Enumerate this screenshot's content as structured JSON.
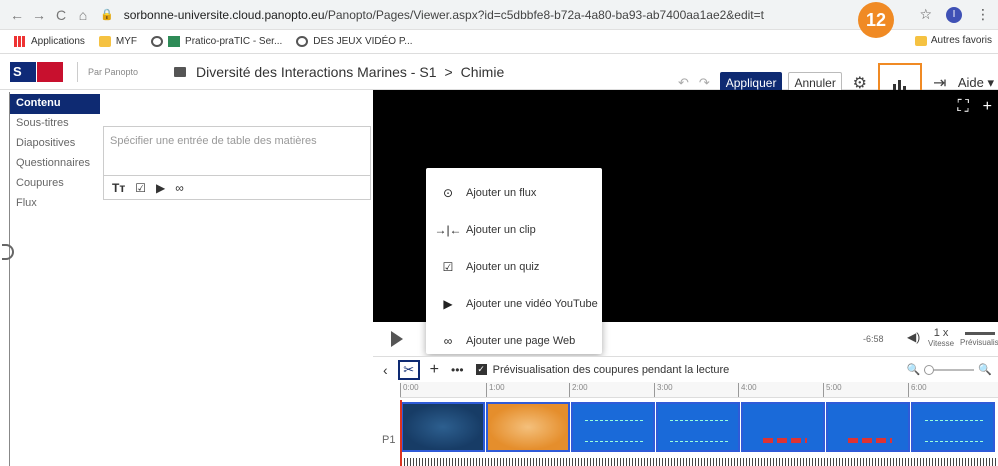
{
  "browser": {
    "url_host": "sorbonne-universite.cloud.panopto.eu",
    "url_path": "/Panopto/Pages/Viewer.aspx?id=c5dbbfe8-b72a-4a80-ba93-ab7400aa1ae2&edit=true",
    "profile_initial": "I",
    "bookmarks": [
      "Applications",
      "MYF",
      "Pratico-praTIC - Ser...",
      "DES JEUX VIDÉO P..."
    ],
    "other_bookmarks": "Autres favoris"
  },
  "header": {
    "partner": "Par Panopto",
    "crumb_folder": "Diversité des Interactions Marines - S1",
    "crumb_session": "Chimie",
    "apply_label": "Appliquer",
    "cancel_label": "Annuler",
    "help_label": "Aide",
    "badge": "12"
  },
  "left_nav": {
    "items": [
      "Contenu",
      "Sous-titres",
      "Diapositives",
      "Questionnaires",
      "Coupures",
      "Flux"
    ]
  },
  "toc": {
    "placeholder": "Spécifier une entrée de table des matières"
  },
  "menu": {
    "items": [
      "Ajouter un flux",
      "Ajouter un clip",
      "Ajouter un quiz",
      "Ajouter une vidéo YouTube",
      "Ajouter une page Web"
    ]
  },
  "player": {
    "time": "-6:58",
    "speed": "1 x",
    "speed_label": "Vitesse",
    "preview_label": "Prévisualisation"
  },
  "timeline": {
    "preview_cuts_label": "Prévisualisation des coupures pendant la lecture",
    "track_label": "P1",
    "ticks": [
      "0:00",
      "1:00",
      "2:00",
      "3:00",
      "4:00",
      "5:00",
      "6:00"
    ]
  },
  "colors": {
    "navy": "#0e2a72",
    "highlight": "#f08a24"
  }
}
